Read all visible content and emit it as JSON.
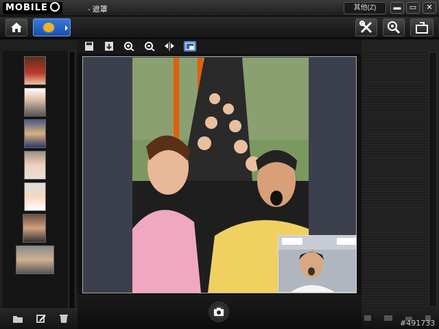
{
  "titlebar": {
    "logo_text": "MOBILE",
    "window_title": "- 遮罩",
    "other_menu_label": "其他(Z)",
    "minimize_symbol": "▬",
    "maximize_symbol": "▭",
    "close_symbol": "✕"
  },
  "toolbar": {
    "icons": [
      "home-icon",
      "effect-mask-icon",
      "tools-icon",
      "webcam-search-icon",
      "share-icon"
    ]
  },
  "edit_toolbar": {
    "icons": [
      "save-icon",
      "import-icon",
      "zoom-in-icon",
      "zoom-out-icon",
      "flip-icon",
      "pip-mode-icon"
    ],
    "active": "pip-mode-icon"
  },
  "thumbnails": {
    "count": 7,
    "items": [
      "portrait-woman-red",
      "portrait-man-gray",
      "portrait-child-costume",
      "portrait-baby",
      "portrait-child-hood",
      "portrait-group-photo",
      "portrait-couple-car"
    ]
  },
  "left_footer": {
    "icons": [
      "open-folder-icon",
      "edit-icon",
      "delete-icon"
    ]
  },
  "center_footer": {
    "icons": [
      "camera-capture-icon"
    ]
  },
  "watermark": "#491733"
}
